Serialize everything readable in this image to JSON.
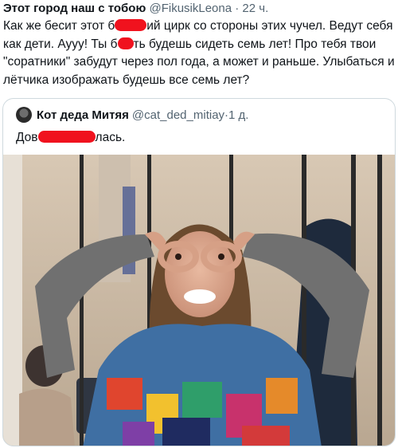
{
  "tweet": {
    "author_name": "Этот город наш с тобою",
    "author_handle": "@FikusikLeona",
    "time": "22 ч.",
    "text_parts": [
      "Как же бесит этот б",
      "ий цирк со стороны этих чучел. Ведут себя как дети. Аууу! Ты б",
      "ть будешь сидеть семь лет! Про тебя твои \"соратники\" забудут через пол года, а может и раньше. Улыбаться и лётчика изображать будешь все семь лет?"
    ]
  },
  "quote": {
    "author_name": "Кот деда Митяя",
    "author_handle": "@cat_ded_mitiay",
    "time": "1 д.",
    "text_parts": [
      "Дов",
      "лась."
    ]
  },
  "photo": {
    "icon": "photo-woman-behind-bars",
    "colors": {
      "wall": "#c9b9a6",
      "bars": "#2a2a2a",
      "sleeves": "#6f6f6f"
    }
  },
  "colors": {
    "redaction": "#f0121e",
    "meta": "#536471",
    "border": "#cfd9de"
  }
}
